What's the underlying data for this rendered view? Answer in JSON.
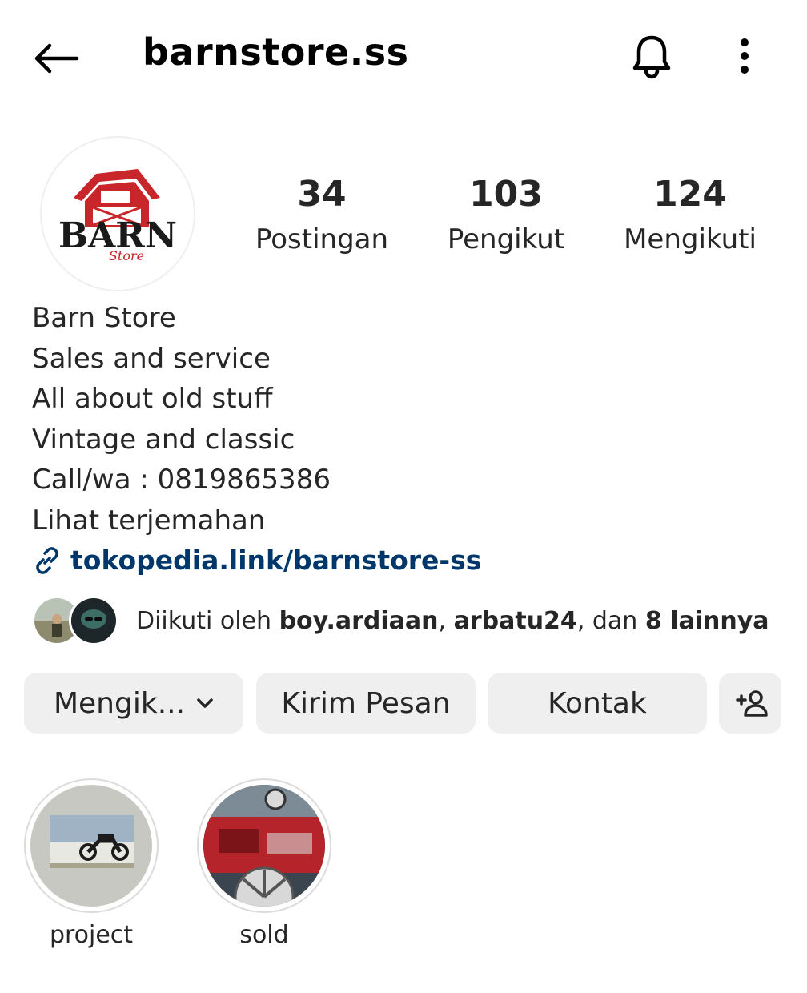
{
  "header": {
    "username": "barnstore.ss",
    "back_icon": "arrow-left-icon",
    "notification_icon": "bell-icon",
    "more_icon": "more-vertical-icon"
  },
  "profile": {
    "avatar_logo_text": "BARN",
    "avatar_logo_subtext": "Store",
    "stats": [
      {
        "value": "34",
        "label": "Postingan"
      },
      {
        "value": "103",
        "label": "Pengikut"
      },
      {
        "value": "124",
        "label": "Mengikuti"
      }
    ]
  },
  "bio": {
    "lines": [
      "Barn Store",
      "Sales and service",
      "All about old stuff",
      "Vintage and classic",
      "Call/wa : 0819865386"
    ],
    "translate_label": "Lihat terjemahan",
    "link": "tokopedia.link/barnstore-ss"
  },
  "followed_by": {
    "prefix": "Diikuti oleh ",
    "user1": "boy.ardiaan",
    "separator": ", ",
    "user2": "arbatu24",
    "middle": ", dan ",
    "others": "8 lainnya"
  },
  "actions": {
    "following_label": "Mengik...",
    "message_label": "Kirim Pesan",
    "contact_label": "Kontak",
    "add_user_icon": "add-person-icon"
  },
  "highlights": [
    {
      "label": "project"
    },
    {
      "label": "sold"
    }
  ],
  "colors": {
    "link": "#00376b",
    "button_bg": "#efefef",
    "brand_red": "#c8262a"
  }
}
